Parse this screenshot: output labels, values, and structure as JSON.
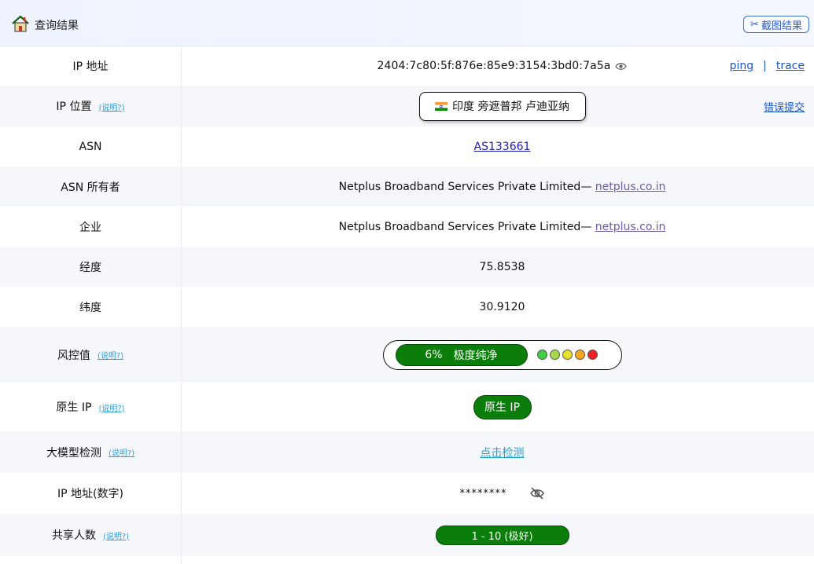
{
  "header": {
    "title": "查询结果",
    "screenshot_button": "截图结果"
  },
  "help_label": "(说明?)",
  "rows": {
    "ip": {
      "label": "IP 地址",
      "value": "2404:7c80:5f:876e:85e9:3154:3bd0:7a5a",
      "ping": "ping",
      "sep": "|",
      "trace": "trace"
    },
    "location": {
      "label": "IP 位置",
      "value": "印度 旁遮普邦 卢迪亚纳",
      "error_link": "错误提交"
    },
    "asn": {
      "label": "ASN",
      "value": "AS133661"
    },
    "asn_owner": {
      "label": "ASN 所有者",
      "name": "Netplus Broadband Services Private Limited",
      "dash": "—",
      "domain": "netplus.co.in"
    },
    "company": {
      "label": "企业",
      "name": "Netplus Broadband Services Private Limited",
      "dash": "—",
      "domain": "netplus.co.in"
    },
    "longitude": {
      "label": "经度",
      "value": "75.8538"
    },
    "latitude": {
      "label": "纬度",
      "value": "30.9120"
    },
    "risk": {
      "label": "风控值",
      "percent": "6%",
      "level": "极度纯净",
      "dots": [
        "#44cc44",
        "#a6d84e",
        "#e6e02a",
        "#f5a623",
        "#ee2222"
      ]
    },
    "native": {
      "label": "原生 IP",
      "badge": "原生 IP"
    },
    "llm": {
      "label": "大模型检测",
      "link": "点击检测"
    },
    "ip_numeric": {
      "label": "IP 地址(数字)",
      "value": "********"
    },
    "shared": {
      "label": "共享人数",
      "value": "1 - 10 (极好)"
    }
  },
  "colors": {
    "green": "#0a7d0a",
    "link_blue": "#1a56c8",
    "help_blue": "#2f9fe0"
  }
}
